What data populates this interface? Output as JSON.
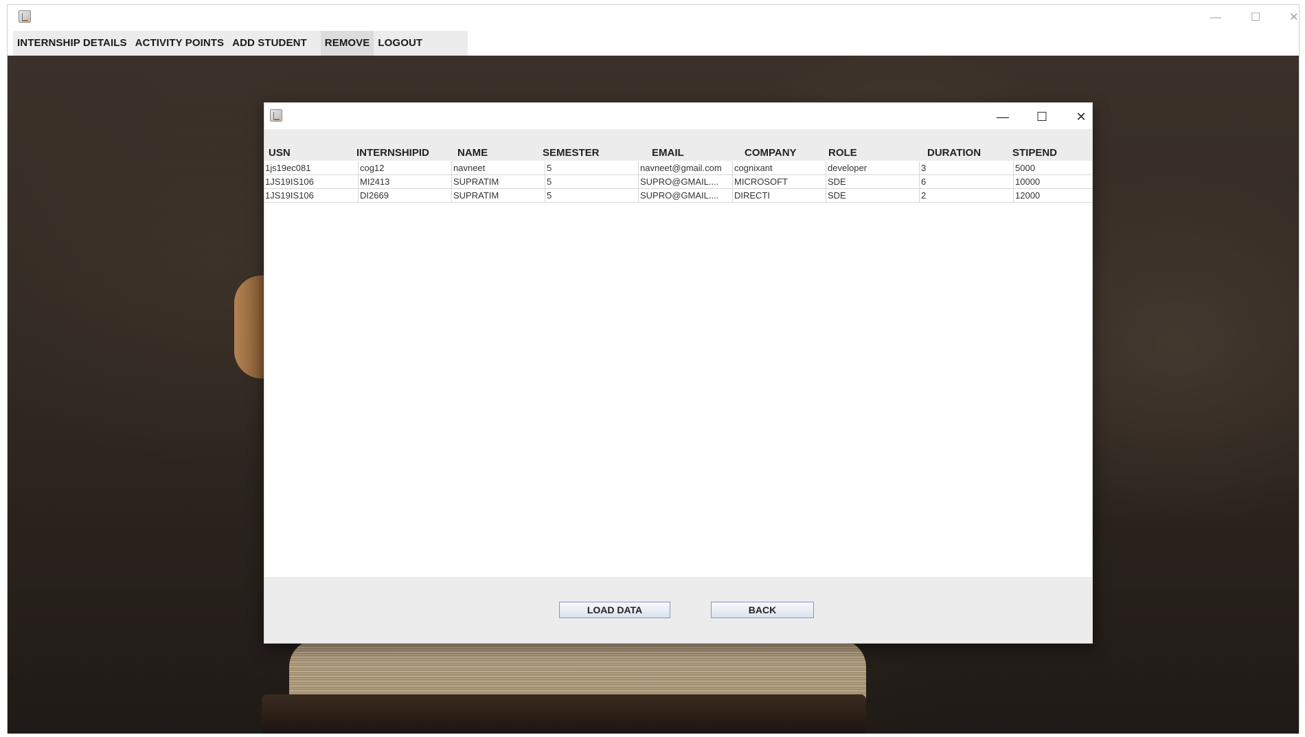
{
  "window": {
    "app_icon": "java-cup-icon",
    "controls": {
      "minimize": "—",
      "maximize": "☐",
      "close": "✕"
    }
  },
  "menubar": {
    "items": [
      "INTERNSHIP DETAILS",
      "ACTIVITY POINTS",
      "ADD STUDENT",
      "REMOVE",
      "LOGOUT"
    ]
  },
  "dialog": {
    "app_icon": "java-cup-icon",
    "controls": {
      "minimize": "—",
      "maximize": "☐",
      "close": "✕"
    },
    "table": {
      "columns": [
        "USN",
        "INTERNSHIPID",
        "NAME",
        "SEMESTER",
        "EMAIL",
        "COMPANY",
        "ROLE",
        "DURATION",
        "STIPEND"
      ],
      "rows": [
        [
          "1js19ec081",
          "cog12",
          "navneet",
          "5",
          "navneet@gmail.com",
          "cognixant",
          "developer",
          "3",
          "5000"
        ],
        [
          "1JS19IS106",
          "MI2413",
          "SUPRATIM",
          "5",
          "SUPRO@GMAIL....",
          "MICROSOFT",
          "SDE",
          "6",
          "10000"
        ],
        [
          "1JS19IS106",
          "DI2669",
          "SUPRATIM",
          "5",
          "SUPRO@GMAIL....",
          "DIRECTI",
          "SDE",
          "2",
          "12000"
        ]
      ]
    },
    "buttons": {
      "load": "LOAD DATA",
      "back": "BACK"
    }
  }
}
